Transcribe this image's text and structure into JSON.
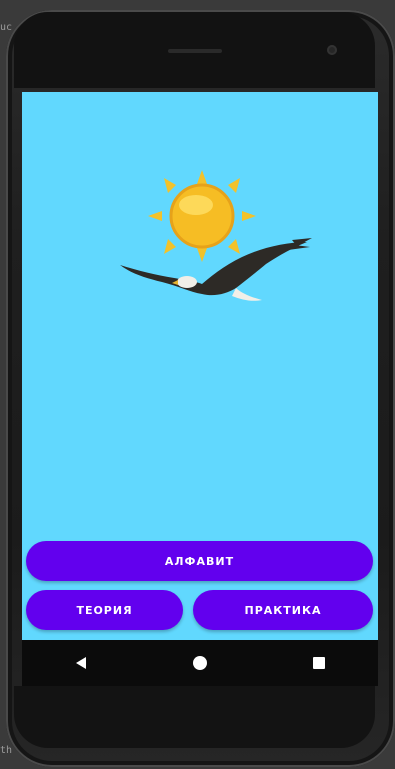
{
  "editor_hints": {
    "top": "uc",
    "bottom": "th"
  },
  "app": {
    "buttons": {
      "alphabet": "АЛФАВИТ",
      "theory": "ТЕОРИЯ",
      "practice": "ПРАКТИКА"
    },
    "colors": {
      "background": "#61d8fe",
      "button": "#6200ee",
      "button_text": "#ffffff"
    }
  },
  "illustration": {
    "sun": "sun-icon",
    "bird": "eagle-illustration"
  },
  "navigation": {
    "back": "back-triangle-icon",
    "home": "home-circle-icon",
    "recents": "recents-square-icon"
  }
}
